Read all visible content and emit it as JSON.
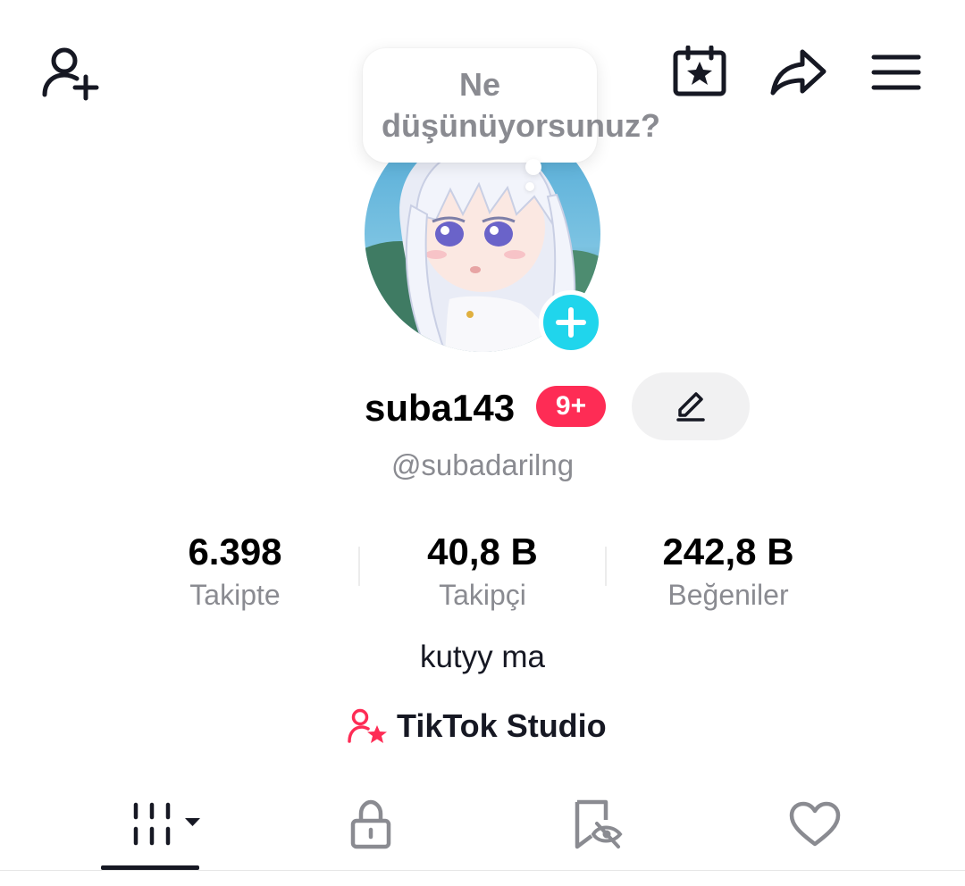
{
  "header": {
    "add_friend_icon": "person-plus-icon",
    "calendar_icon": "calendar-star-icon",
    "share_icon": "share-arrow-icon",
    "menu_icon": "hamburger-menu-icon"
  },
  "bubble": {
    "text": "Ne düşünüyorsunuz?"
  },
  "profile": {
    "username": "suba143",
    "notification_badge": "9+",
    "handle": "@subadarilng",
    "edit_icon": "pencil-icon"
  },
  "stats": [
    {
      "value": "6.398",
      "label": "Takipte"
    },
    {
      "value": "40,8 B",
      "label": "Takipçi"
    },
    {
      "value": "242,8 B",
      "label": "Beğeniler"
    }
  ],
  "bio": "kutyy ma",
  "studio": {
    "label": "TikTok Studio",
    "icon": "creator-star-icon"
  },
  "tabs": [
    {
      "icon": "videos-grid-icon",
      "active": true
    },
    {
      "icon": "lock-icon",
      "active": false
    },
    {
      "icon": "bookmark-eye-icon",
      "active": false
    },
    {
      "icon": "heart-icon",
      "active": false
    }
  ],
  "colors": {
    "accent_red": "#fe2c55",
    "accent_cyan": "#20d5ec",
    "text_primary": "#161823",
    "text_secondary": "#8a8b91"
  }
}
